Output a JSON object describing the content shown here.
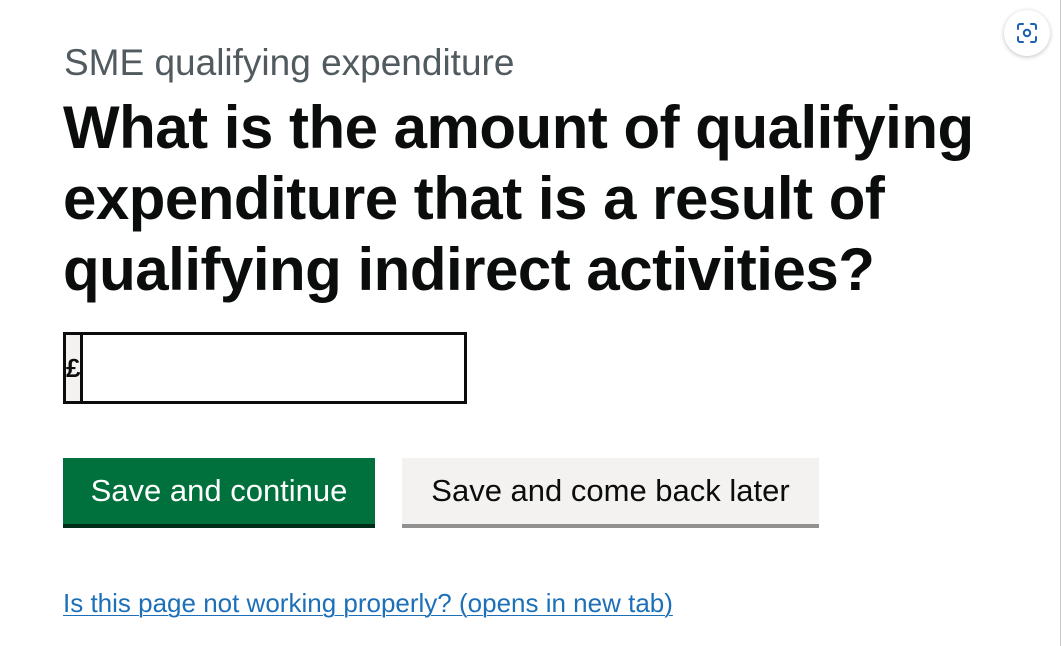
{
  "page": {
    "caption": "SME qualifying expenditure",
    "heading": "What is the amount of qualifying expenditure that is a result of qualifying indirect activities?"
  },
  "amount_field": {
    "prefix": "£",
    "value": ""
  },
  "buttons": {
    "primary_label": "Save and continue",
    "secondary_label": "Save and come back later"
  },
  "help_link": {
    "text": "Is this page not working properly? (opens in new tab)"
  },
  "icons": {
    "lens": "visual-search-icon"
  },
  "colors": {
    "primary_button": "#00703c",
    "secondary_button": "#f3f2f1",
    "link": "#1d70b8",
    "caption": "#505a5f",
    "text": "#0b0c0c"
  }
}
